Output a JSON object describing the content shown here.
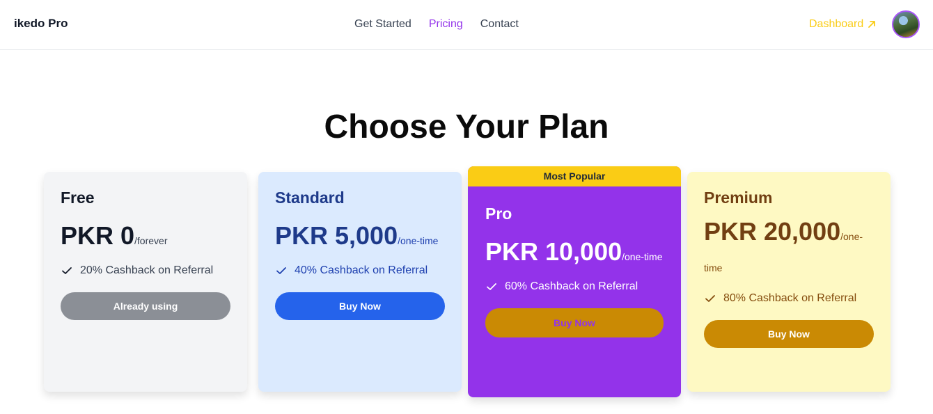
{
  "header": {
    "brand": "ikedo Pro",
    "nav": [
      {
        "label": "Get Started",
        "active": false
      },
      {
        "label": "Pricing",
        "active": true
      },
      {
        "label": "Contact",
        "active": false
      }
    ],
    "dashboard_label": "Dashboard",
    "dashboard_icon": "arrow-up-right-icon",
    "avatar_icon": "user-avatar",
    "accent_color": "#9333ea",
    "dashboard_color": "#facc15"
  },
  "main": {
    "title": "Choose Your Plan"
  },
  "plans": [
    {
      "name": "Free",
      "price": "PKR 0",
      "suffix": "/forever",
      "feature": "20% Cashback on Referral",
      "button": "Already using",
      "bg": "#f3f4f6",
      "button_color": "#8b8f96"
    },
    {
      "name": "Standard",
      "price": "PKR 5,000",
      "suffix": "/one-time",
      "feature": "40% Cashback on Referral",
      "button": "Buy Now",
      "bg": "#dbeafe",
      "button_color": "#2563eb"
    },
    {
      "badge": "Most Popular",
      "name": "Pro",
      "price": "PKR 10,000",
      "suffix": "/one-time",
      "feature": "60% Cashback on Referral",
      "button": "Buy Now",
      "bg": "#9333ea",
      "button_color": "#ca8a04"
    },
    {
      "name": "Premium",
      "price": "PKR 20,000",
      "suffix": "/one-time",
      "feature": "80% Cashback on Referral",
      "button": "Buy Now",
      "bg": "#fef9c3",
      "button_color": "#ca8a04"
    }
  ]
}
